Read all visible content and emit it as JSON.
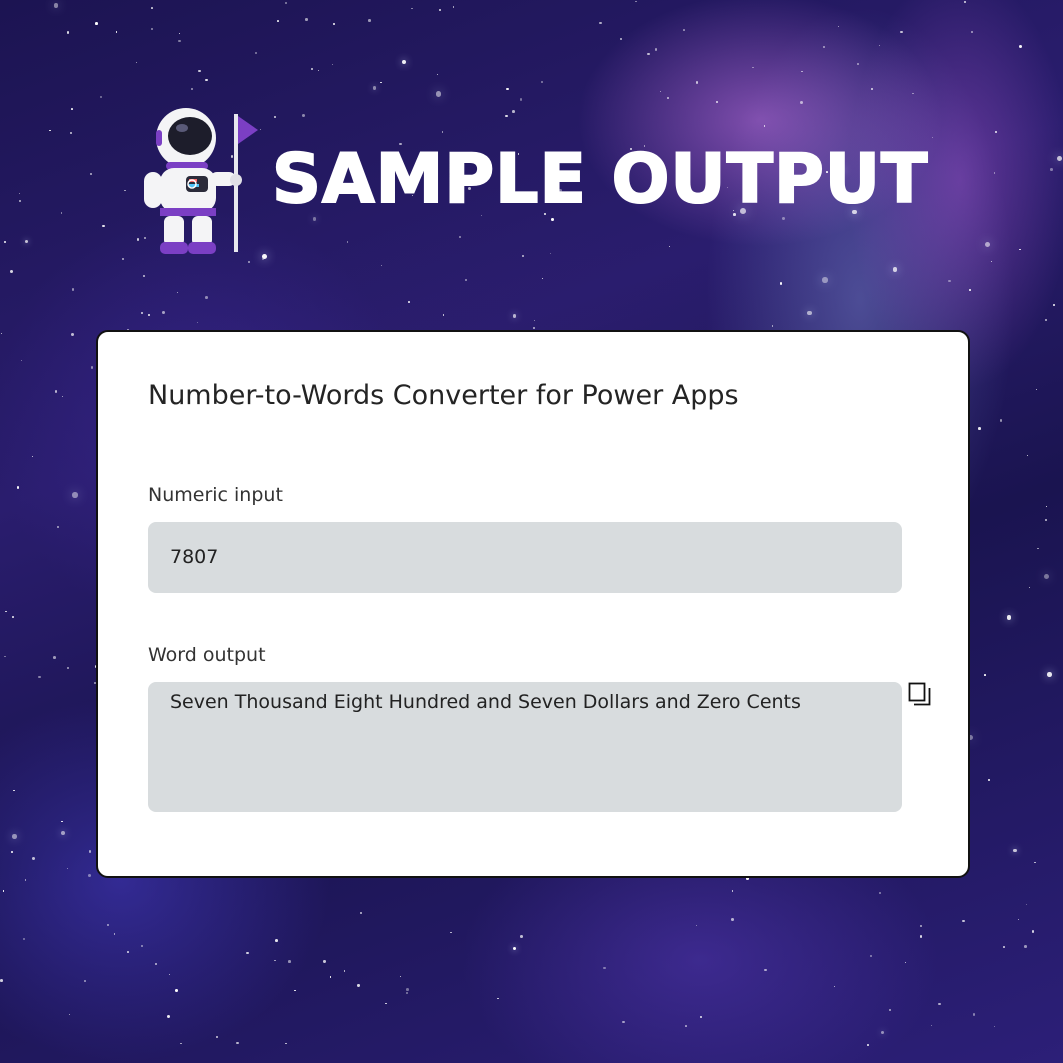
{
  "header": {
    "title": "SAMPLE OUTPUT",
    "mascot_icon": "astronaut-with-flag-icon"
  },
  "card": {
    "title": "Number-to-Words Converter for Power Apps",
    "numeric_input": {
      "label": "Numeric input",
      "value": "7807"
    },
    "word_output": {
      "label": "Word output",
      "value": "Seven Thousand Eight Hundred and Seven Dollars and Zero Cents",
      "copy_icon": "copy-icon"
    }
  },
  "colors": {
    "background": "#221a5e",
    "card": "#ffffff",
    "field": "#d8dcde",
    "accent": "#7b3fc4"
  }
}
